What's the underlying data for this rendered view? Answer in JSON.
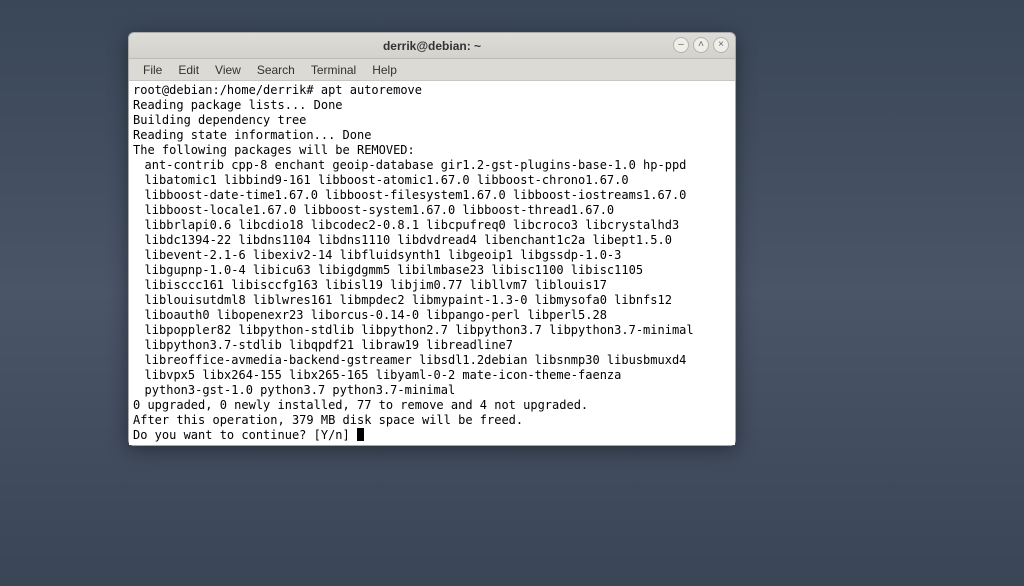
{
  "window": {
    "title": "derrik@debian: ~"
  },
  "menubar": [
    "File",
    "Edit",
    "View",
    "Search",
    "Terminal",
    "Help"
  ],
  "terminal": {
    "prompt": "root@debian:/home/derrik# ",
    "command": "apt autoremove",
    "intro": [
      "Reading package lists... Done",
      "Building dependency tree",
      "Reading state information... Done",
      "The following packages will be REMOVED:"
    ],
    "packages": [
      "ant-contrib cpp-8 enchant geoip-database gir1.2-gst-plugins-base-1.0 hp-ppd",
      "libatomic1 libbind9-161 libboost-atomic1.67.0 libboost-chrono1.67.0",
      "libboost-date-time1.67.0 libboost-filesystem1.67.0 libboost-iostreams1.67.0",
      "libboost-locale1.67.0 libboost-system1.67.0 libboost-thread1.67.0",
      "libbrlapi0.6 libcdio18 libcodec2-0.8.1 libcpufreq0 libcroco3 libcrystalhd3",
      "libdc1394-22 libdns1104 libdns1110 libdvdread4 libenchant1c2a libept1.5.0",
      "libevent-2.1-6 libexiv2-14 libfluidsynth1 libgeoip1 libgssdp-1.0-3",
      "libgupnp-1.0-4 libicu63 libigdgmm5 libilmbase23 libisc1100 libisc1105",
      "libisccc161 libisccfg163 libisl19 libjim0.77 libllvm7 liblouis17",
      "liblouisutdml8 liblwres161 libmpdec2 libmypaint-1.3-0 libmysofa0 libnfs12",
      "liboauth0 libopenexr23 liborcus-0.14-0 libpango-perl libperl5.28",
      "libpoppler82 libpython-stdlib libpython2.7 libpython3.7 libpython3.7-minimal",
      "libpython3.7-stdlib libqpdf21 libraw19 libreadline7",
      "libreoffice-avmedia-backend-gstreamer libsdl1.2debian libsnmp30 libusbmuxd4",
      "libvpx5 libx264-155 libx265-165 libyaml-0-2 mate-icon-theme-faenza",
      "python3-gst-1.0 python3.7 python3.7-minimal"
    ],
    "summary": [
      "0 upgraded, 0 newly installed, 77 to remove and 4 not upgraded.",
      "After this operation, 379 MB disk space will be freed."
    ],
    "confirm": "Do you want to continue? [Y/n] "
  }
}
